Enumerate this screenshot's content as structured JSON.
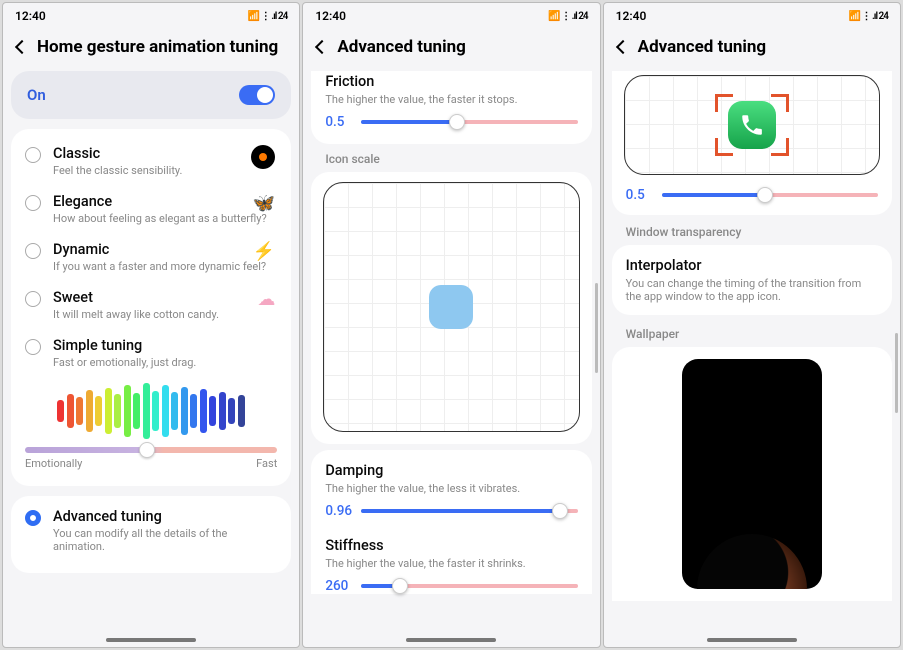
{
  "status": {
    "time": "12:40",
    "battery": "24"
  },
  "panel1": {
    "title": "Home gesture animation tuning",
    "on_label": "On",
    "options": [
      {
        "title": "Classic",
        "desc": "Feel the classic sensibility."
      },
      {
        "title": "Elegance",
        "desc": "How about feeling as elegant as a butterfly?"
      },
      {
        "title": "Dynamic",
        "desc": "If you want a faster and more dynamic feel?"
      },
      {
        "title": "Sweet",
        "desc": "It will melt away like cotton candy."
      }
    ],
    "simple": {
      "title": "Simple tuning",
      "desc": "Fast or emotionally, just drag."
    },
    "emo_left": "Emotionally",
    "emo_right": "Fast",
    "advanced": {
      "title": "Advanced tuning",
      "desc": "You can modify all the details of the animation."
    }
  },
  "panel2": {
    "title": "Advanced tuning",
    "friction": {
      "label": "Friction",
      "desc": "The higher the value, the faster it stops.",
      "value": "0.5",
      "fill": 44
    },
    "icon_scale_header": "Icon scale",
    "damping": {
      "label": "Damping",
      "desc": "The higher the value, the less it vibrates.",
      "value": "0.96",
      "fill": 92
    },
    "stiffness": {
      "label": "Stiffness",
      "desc": "The higher the value, the faster it shrinks.",
      "value": "260",
      "fill": 18
    }
  },
  "panel3": {
    "title": "Advanced tuning",
    "topslider": {
      "value": "0.5",
      "fill": 48
    },
    "window_header": "Window transparency",
    "interpolator": {
      "title": "Interpolator",
      "desc": "You can change the timing of the transition from the app window to the app icon."
    },
    "wallpaper_header": "Wallpaper"
  },
  "icons": {
    "butterfly": "🦋",
    "bolt": "⚡",
    "candy": "☁"
  }
}
